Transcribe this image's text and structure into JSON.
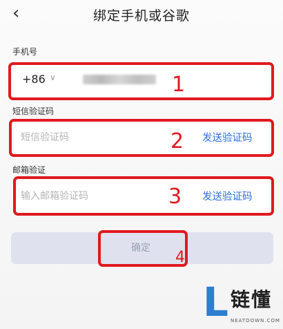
{
  "header": {
    "title": "绑定手机或谷歌",
    "back_icon": "‹"
  },
  "phone": {
    "label": "手机号",
    "country_code": "+86",
    "chevron": "∨"
  },
  "sms": {
    "label": "短信验证码",
    "placeholder": "短信验证码",
    "send_label": "发送验证码"
  },
  "email": {
    "label": "邮箱验证",
    "placeholder": "输入邮箱验证码",
    "send_label": "发送验证码"
  },
  "confirm": {
    "label": "确定"
  },
  "annotations": {
    "n1": "1",
    "n2": "2",
    "n3": "3",
    "n4": "4"
  },
  "watermark": {
    "brand": "链懂",
    "site": "NEATDOWN.COM"
  },
  "colors": {
    "highlight": "#e0191f",
    "link": "#2b6fdc",
    "button_disabled": "#dfe2ee",
    "watermark_blue": "#2d7ed0"
  }
}
